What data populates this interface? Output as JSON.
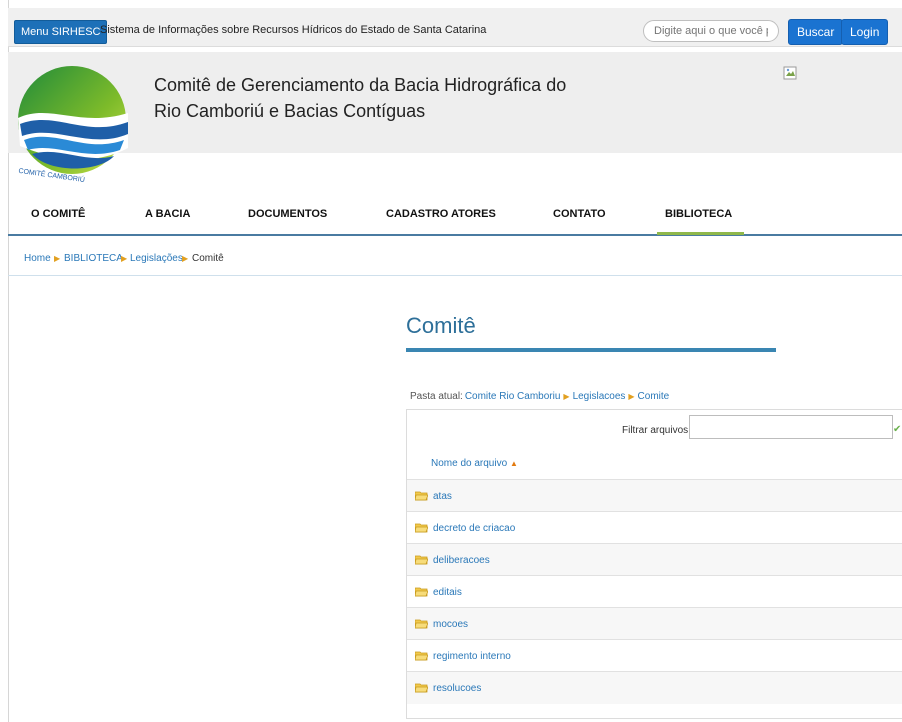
{
  "topbar": {
    "menu_label": "Menu SIRHESC",
    "system_title": "Sistema de Informações sobre Recursos Hídricos do Estado de Santa Catarina",
    "search_placeholder": "Digite aqui o que você pr",
    "search_button": "Buscar",
    "login_button": "Login"
  },
  "header": {
    "title_line1": "Comitê de Gerenciamento da Bacia Hidrográfica do",
    "title_line2": "Rio Camboriú e Bacias Contíguas",
    "logo_text": "COMITÊ CAMBORIÚ"
  },
  "nav": {
    "items": [
      "O COMITÊ",
      "A BACIA",
      "DOCUMENTOS",
      "CADASTRO ATORES",
      "CONTATO",
      "BIBLIOTECA"
    ],
    "active": "BIBLIOTECA"
  },
  "breadcrumb": [
    "Home",
    "BIBLIOTECA",
    "Legislações",
    "Comitê"
  ],
  "page": {
    "title": "Comitê",
    "pasta_label": "Pasta atual:",
    "pasta_path": [
      "Comite Rio Camboriu",
      "Legislacoes",
      "Comite"
    ],
    "filter_label": "Filtrar arquivos:",
    "column_header": "Nome do arquivo"
  },
  "folders": [
    "atas",
    "decreto de criacao",
    "deliberacoes",
    "editais",
    "mocoes",
    "regimento interno",
    "resolucoes"
  ],
  "colors": {
    "accent_blue": "#1a73d1",
    "nav_active": "#8fb84a",
    "link": "#2a78b8"
  }
}
